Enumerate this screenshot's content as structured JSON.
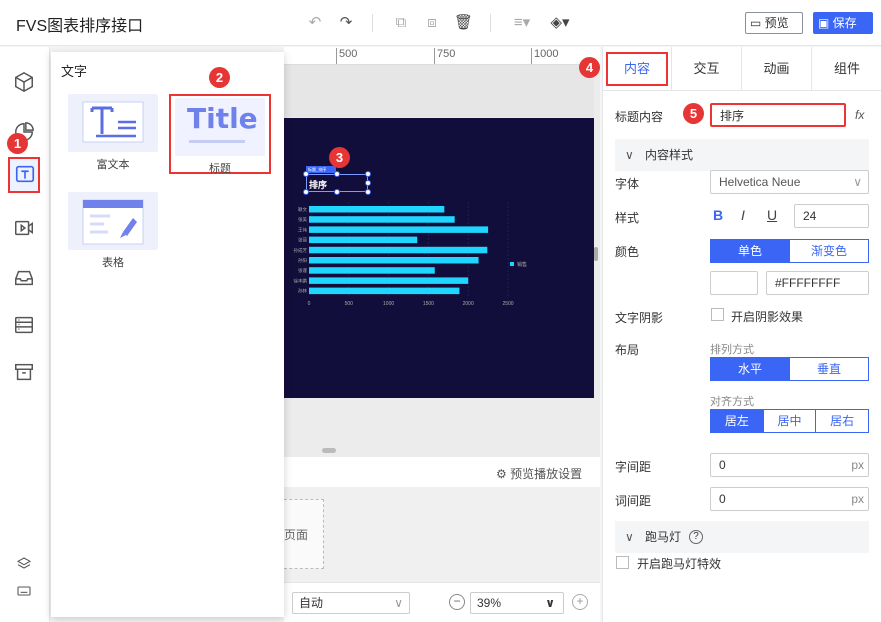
{
  "app": {
    "title": "FVS图表排序接口"
  },
  "header": {
    "preview_label": "预览",
    "save_label": "保存"
  },
  "panel": {
    "title": "文字",
    "components": [
      {
        "label": "富文本",
        "icon": "rich-text-icon"
      },
      {
        "label": "标题",
        "thumb_text": "Title",
        "icon": "title-icon"
      },
      {
        "label": "表格",
        "icon": "table-component-icon"
      }
    ]
  },
  "ruler": {
    "ticks": [
      "500",
      "750",
      "1000"
    ]
  },
  "canvas": {
    "title_widget_label": "标题_排序",
    "title_text": "排序",
    "preview_settings_label": "预览播放设置",
    "page_label": "页面",
    "fit_select": "自动",
    "zoom": "39%"
  },
  "chart_data": {
    "type": "bar",
    "orientation": "horizontal",
    "categories": [
      "颖文",
      "张美",
      "王伟",
      "张丽",
      "孙成芳",
      "孙阳",
      "张谨",
      "徐丰鹏",
      "孙林"
    ],
    "series": [
      {
        "name": "销售",
        "values": [
          1700,
          1830,
          2250,
          1360,
          2240,
          2130,
          1580,
          2000,
          1890
        ]
      }
    ],
    "xticks": [
      "0",
      "500",
      "1000",
      "1500",
      "2000",
      "2500"
    ],
    "xlim": [
      0,
      2500
    ],
    "bar_color": "#1ed6ff",
    "background": "#120e3b"
  },
  "right_panel": {
    "tabs": [
      "内容",
      "交互",
      "动画",
      "组件"
    ],
    "title_content_label": "标题内容",
    "title_content_value": "排序",
    "fx_label": "fx",
    "style_section": "内容样式",
    "font_label": "字体",
    "font_value": "Helvetica Neue",
    "style_label": "样式",
    "bold": "B",
    "italic": "I",
    "underline": "U",
    "font_size": "24",
    "color_label": "颜色",
    "color_single": "单色",
    "color_gradient": "渐变色",
    "color_value": "#FFFFFFFF",
    "shadow_label": "文字阴影",
    "shadow_check": "开启阴影效果",
    "layout_label": "布局",
    "arrange_label": "排列方式",
    "arrange_h": "水平",
    "arrange_v": "垂直",
    "align_label": "对齐方式",
    "align_left": "居左",
    "align_center": "居中",
    "align_right": "居右",
    "letter_spacing_label": "字间距",
    "letter_spacing_value": "0",
    "word_spacing_label": "词间距",
    "word_spacing_value": "0",
    "unit_px": "px",
    "marquee_section": "跑马灯",
    "marquee_check": "开启跑马灯特效"
  },
  "badges": [
    "1",
    "2",
    "3",
    "4",
    "5"
  ],
  "colors": {
    "accent": "#3b66f5",
    "highlight": "#e33333"
  }
}
